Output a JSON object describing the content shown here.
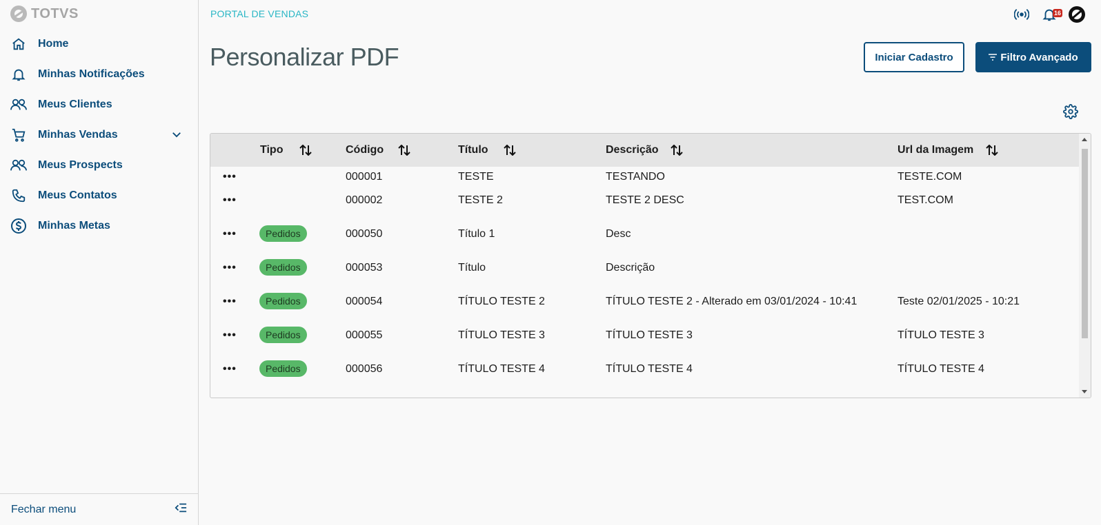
{
  "brand": {
    "logo_text": "TOTVS"
  },
  "sidebar": {
    "items": [
      {
        "label": "Home",
        "icon": "home-icon"
      },
      {
        "label": "Minhas Notificações",
        "icon": "bell-icon"
      },
      {
        "label": "Meus Clientes",
        "icon": "users-icon"
      },
      {
        "label": "Minhas Vendas",
        "icon": "cart-icon"
      },
      {
        "label": "Meus Prospects",
        "icon": "users-icon"
      },
      {
        "label": "Meus Contatos",
        "icon": "phone-icon"
      },
      {
        "label": "Minhas Metas",
        "icon": "dollar-icon"
      }
    ],
    "footer_label": "Fechar menu"
  },
  "header": {
    "portal_title": "PORTAL DE VENDAS",
    "notification_count": "16"
  },
  "page": {
    "title": "Personalizar PDF",
    "btn_start": "Iniciar Cadastro",
    "btn_filter": "Filtro Avançado"
  },
  "table": {
    "columns": [
      "Tipo",
      "Código",
      "Título",
      "Descrição",
      "Url da Imagem"
    ],
    "rows": [
      {
        "tipo": "",
        "codigo": "000001",
        "titulo": "TESTE",
        "descricao": "TESTANDO",
        "url": "TESTE.COM"
      },
      {
        "tipo": "",
        "codigo": "000002",
        "titulo": "TESTE 2",
        "descricao": "TESTE 2 DESC",
        "url": "TEST.COM"
      },
      {
        "tipo": "Pedidos",
        "codigo": "000050",
        "titulo": "Título 1",
        "descricao": "Desc",
        "url": ""
      },
      {
        "tipo": "Pedidos",
        "codigo": "000053",
        "titulo": "Título",
        "descricao": "Descrição",
        "url": ""
      },
      {
        "tipo": "Pedidos",
        "codigo": "000054",
        "titulo": "TÍTULO TESTE 2",
        "descricao": "TÍTULO TESTE 2 - Alterado em 03/01/2024 - 10:41",
        "url": "Teste 02/01/2025 - 10:21"
      },
      {
        "tipo": "Pedidos",
        "codigo": "000055",
        "titulo": "TÍTULO TESTE 3",
        "descricao": "TÍTULO TESTE 3",
        "url": "TÍTULO TESTE 3"
      },
      {
        "tipo": "Pedidos",
        "codigo": "000056",
        "titulo": "TÍTULO TESTE 4",
        "descricao": "TÍTULO TESTE 4",
        "url": "TÍTULO TESTE 4"
      }
    ],
    "row_actions": "•••"
  },
  "colors": {
    "primary": "#0c4d7b",
    "accent": "#29b6c5",
    "tag": "#58b868",
    "badge": "#c8291f"
  }
}
